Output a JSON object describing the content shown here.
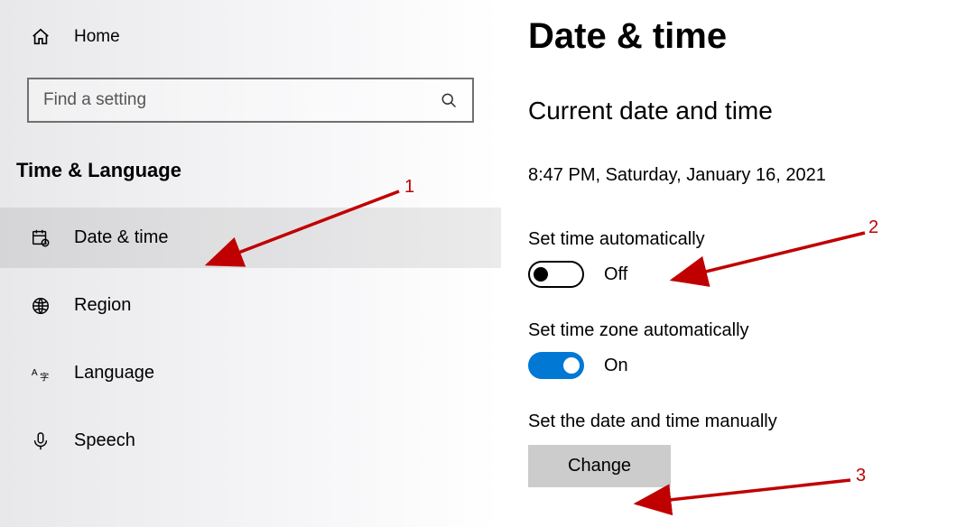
{
  "sidebar": {
    "home_label": "Home",
    "search_placeholder": "Find a setting",
    "section_title": "Time & Language",
    "items": [
      {
        "label": "Date & time",
        "icon": "calendar-icon"
      },
      {
        "label": "Region",
        "icon": "globe-icon"
      },
      {
        "label": "Language",
        "icon": "language-icon"
      },
      {
        "label": "Speech",
        "icon": "mic-icon"
      }
    ]
  },
  "main": {
    "page_title": "Date & time",
    "subheading": "Current date and time",
    "current_datetime": "8:47 PM, Saturday, January 16, 2021",
    "auto_time_label": "Set time automatically",
    "auto_time_state": "Off",
    "auto_tz_label": "Set time zone automatically",
    "auto_tz_state": "On",
    "manual_label": "Set the date and time manually",
    "change_button": "Change"
  },
  "annotations": {
    "label1": "1",
    "label2": "2",
    "label3": "3"
  }
}
